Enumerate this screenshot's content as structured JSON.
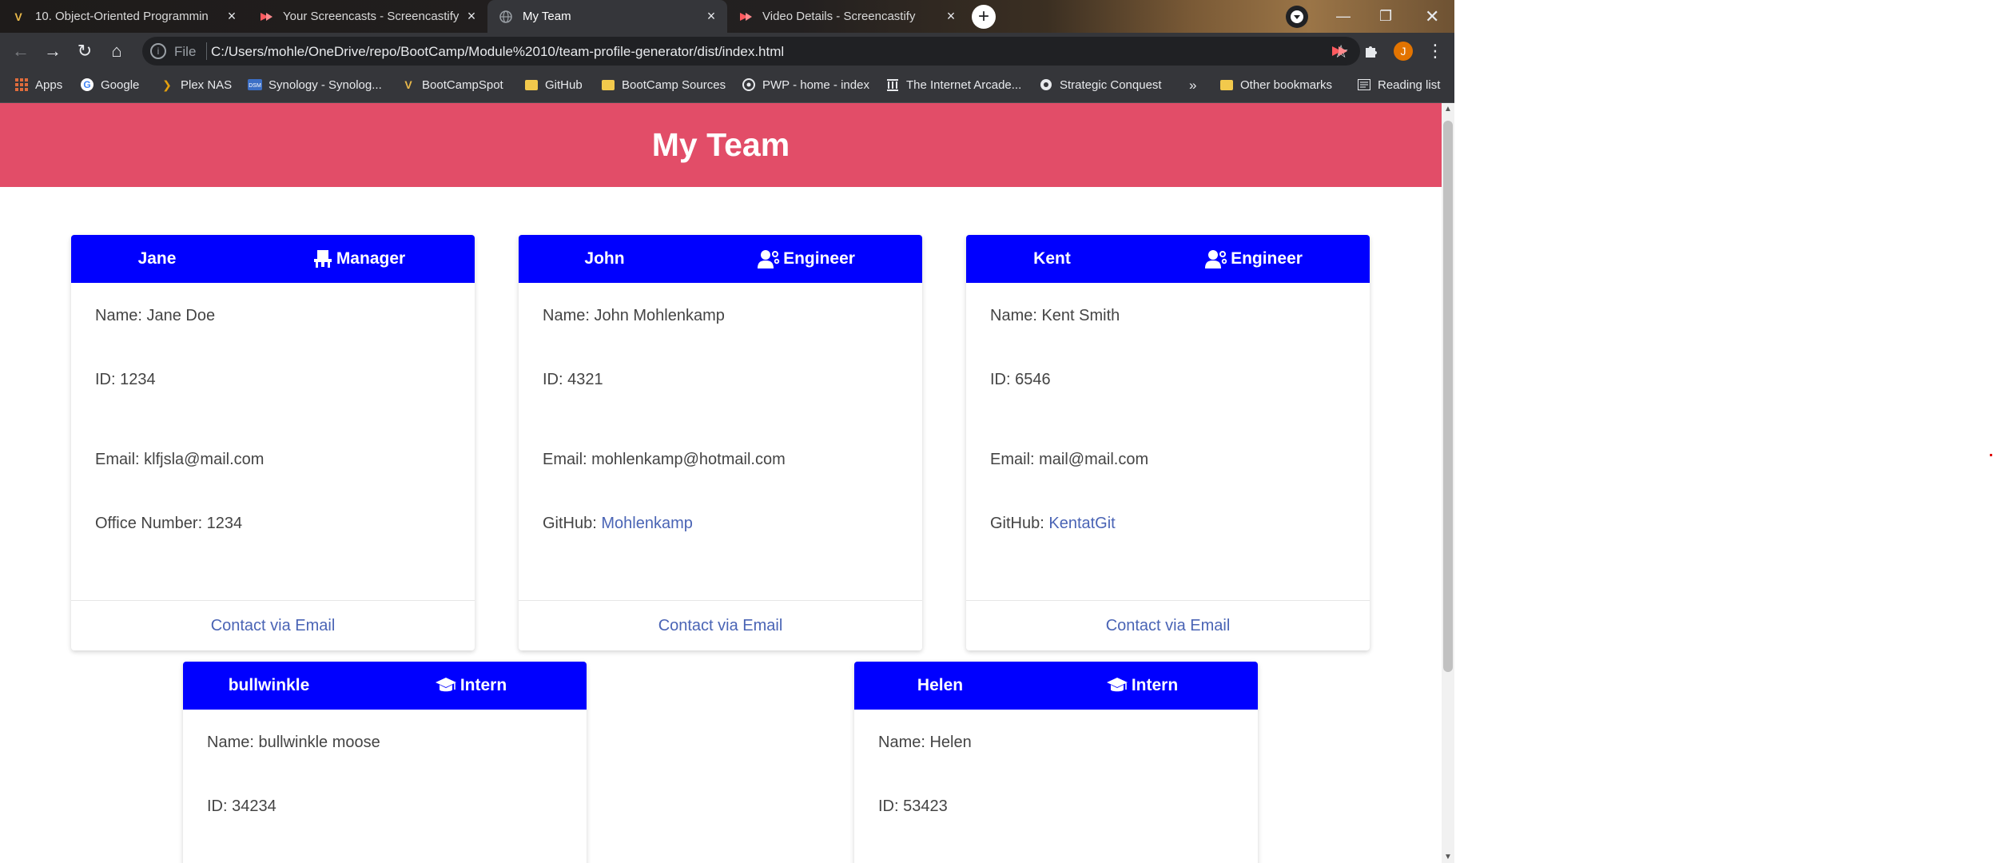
{
  "browser": {
    "tabs": [
      {
        "title": "10. Object-Oriented Programmin",
        "favicon": "V"
      },
      {
        "title": "Your Screencasts - Screencastify",
        "favicon": "screencastify-icon"
      },
      {
        "title": "My Team",
        "favicon": "globe-icon"
      },
      {
        "title": "Video Details - Screencastify",
        "favicon": "screencastify-icon"
      }
    ],
    "new_tab": "+",
    "address": {
      "scheme": "File",
      "url": "C:/Users/mohle/OneDrive/repo/BootCamp/Module%2010/team-profile-generator/dist/index.html"
    },
    "profile_initial": "J",
    "bookmarks": [
      {
        "label": "Apps",
        "icon": "apps-grid-icon"
      },
      {
        "label": "Google",
        "icon": "google-icon"
      },
      {
        "label": "Plex NAS",
        "icon": "plex-icon"
      },
      {
        "label": "Synology - Synolog...",
        "icon": "synology-icon"
      },
      {
        "label": "BootCampSpot",
        "icon": "v-icon"
      },
      {
        "label": "GitHub",
        "icon": "folder-icon"
      },
      {
        "label": "BootCamp Sources",
        "icon": "folder-icon"
      },
      {
        "label": "PWP - home - index",
        "icon": "pwp-icon"
      },
      {
        "label": "The Internet Arcade...",
        "icon": "archive-icon"
      },
      {
        "label": "Strategic Conquest",
        "icon": "strategic-icon"
      }
    ],
    "overflow": "»",
    "other_bookmarks": "Other bookmarks",
    "reading_list": "Reading list",
    "colors": {
      "tab_active": "#35363a",
      "toolbar": "#35363a"
    }
  },
  "header": {
    "title": "My Team",
    "color": "#e24d68"
  },
  "colors": {
    "card_header": "#0000ff",
    "link": "#4a64b5"
  },
  "cards": [
    {
      "name": "Jane",
      "role": "Manager",
      "role_icon": "manager-chair-icon",
      "rows": [
        "Name: Jane Doe",
        "ID: 1234",
        "Email: klfjsla@mail.com",
        "Office Number: 1234"
      ],
      "footer": "Contact via Email"
    },
    {
      "name": "John",
      "role": "Engineer",
      "role_icon": "engineer-user-icon",
      "rows": [
        "Name: John Mohlenkamp",
        "ID: 4321",
        "Email: mohlenkamp@hotmail.com"
      ],
      "github_label": "GitHub: ",
      "github_user": "Mohlenkamp",
      "footer": "Contact via Email"
    },
    {
      "name": "Kent",
      "role": "Engineer",
      "role_icon": "engineer-user-icon",
      "rows": [
        "Name: Kent Smith",
        "ID: 6546",
        "Email: mail@mail.com"
      ],
      "github_label": "GitHub: ",
      "github_user": "KentatGit",
      "footer": "Contact via Email"
    },
    {
      "name": "bullwinkle",
      "role": "Intern",
      "role_icon": "graduation-cap-icon",
      "rows": [
        "Name: bullwinkle moose",
        "ID: 34234"
      ]
    },
    {
      "name": "Helen",
      "role": "Intern",
      "role_icon": "graduation-cap-icon",
      "rows": [
        "Name: Helen",
        "ID: 53423"
      ]
    }
  ]
}
